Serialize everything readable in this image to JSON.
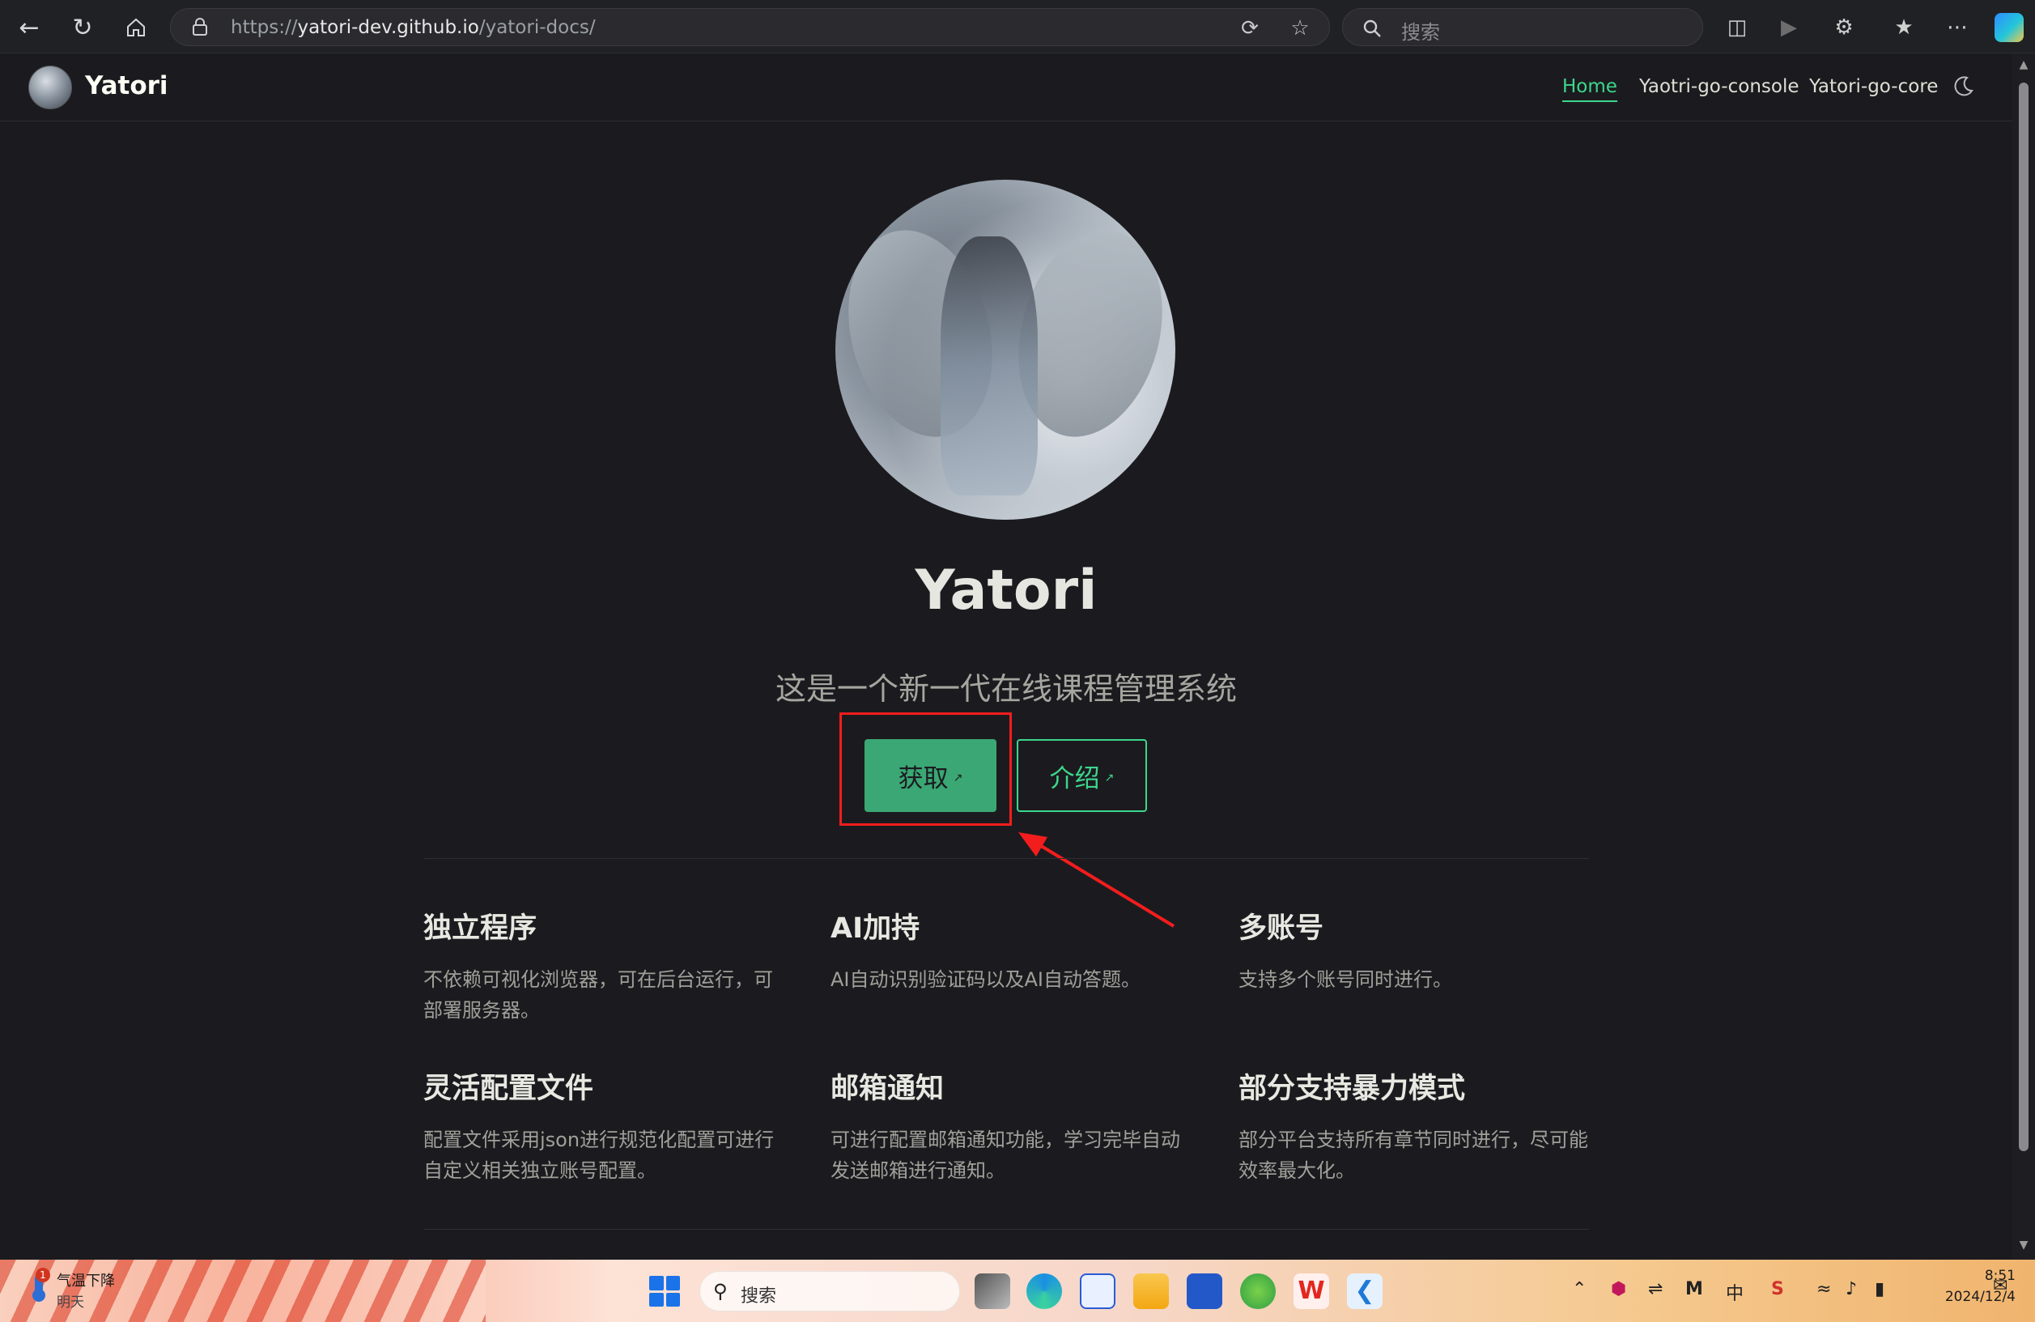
{
  "browser": {
    "url_prefix": "https://",
    "url_host": "yatori-dev.github.io",
    "url_path": "/yatori-docs/",
    "search_placeholder": "搜索"
  },
  "site": {
    "title": "Yatori",
    "nav": [
      {
        "label": "Home",
        "active": true
      },
      {
        "label": "Yaotri-go-console",
        "active": false
      },
      {
        "label": "Yatori-go-core",
        "active": false
      }
    ]
  },
  "hero": {
    "name": "Yatori",
    "tagline": "这是一个新一代在线课程管理系统",
    "primary_action": "获取",
    "secondary_action": "介绍",
    "ext_glyph": "↗"
  },
  "features": [
    {
      "title": "独立程序",
      "details": [
        "不依赖可视化浏览器，可在后台运行，可",
        "部署服务器。"
      ]
    },
    {
      "title": "AI加持",
      "details": [
        "AI自动识别验证码以及AI自动答题。"
      ]
    },
    {
      "title": "多账号",
      "details": [
        "支持多个账号同时进行。"
      ]
    },
    {
      "title": "灵活配置文件",
      "details": [
        "配置文件采用json进行规范化配置可进行",
        "自定义相关独立账号配置。"
      ]
    },
    {
      "title": "邮箱通知",
      "details": [
        "可进行配置邮箱通知功能，学习完毕自动",
        "发送邮箱进行通知。"
      ]
    },
    {
      "title": "部分支持暴力模式",
      "details": [
        "部分平台支持所有章节同时进行，尽可能",
        "效率最大化。"
      ]
    }
  ],
  "taskbar": {
    "weather_badge": "1",
    "weather_line1": "气温下降",
    "weather_line2": "明天",
    "search_placeholder": "搜索",
    "ime_label": "中",
    "time": "8:51",
    "date": "2024/12/4"
  },
  "colors": {
    "accent": "#3dd68c",
    "button_fill": "#3aa775",
    "background": "#1b1b1f",
    "annotation_red": "#f31d1d"
  }
}
